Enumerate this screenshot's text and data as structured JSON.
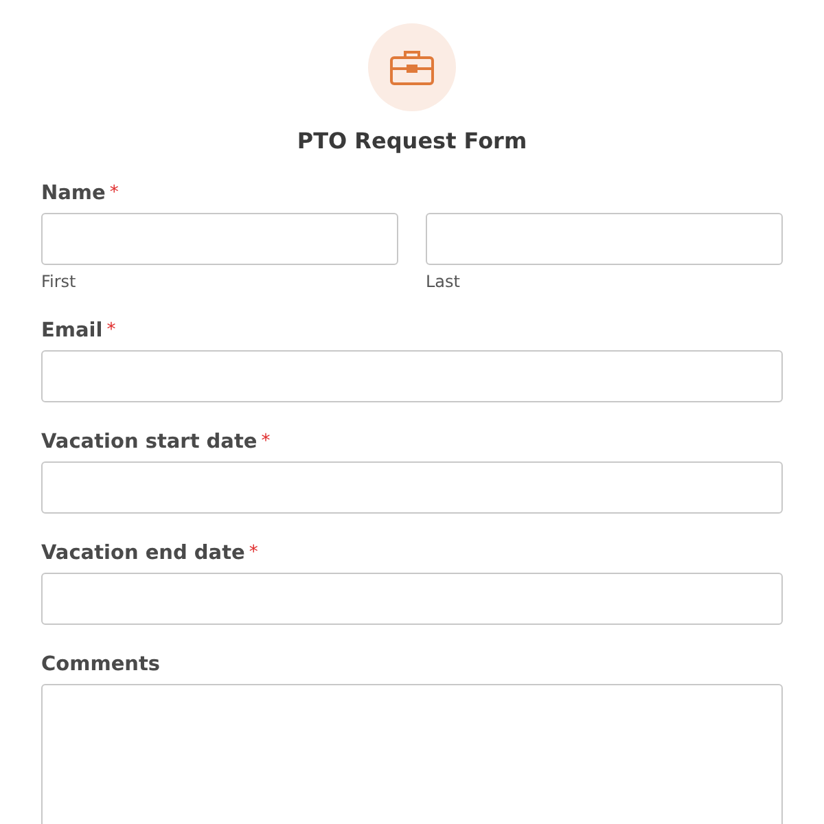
{
  "form": {
    "title": "PTO Request Form"
  },
  "fields": [
    {
      "kind": "name",
      "label": "Name",
      "required_mark": "*",
      "parts": [
        {
          "sublabel": "First"
        },
        {
          "sublabel": "Last"
        }
      ]
    },
    {
      "kind": "text",
      "label": "Email",
      "required_mark": "*"
    },
    {
      "kind": "text",
      "label": "Vacation start date",
      "required_mark": "*"
    },
    {
      "kind": "text",
      "label": "Vacation end date",
      "required_mark": "*"
    },
    {
      "kind": "textarea",
      "label": "Comments"
    }
  ]
}
